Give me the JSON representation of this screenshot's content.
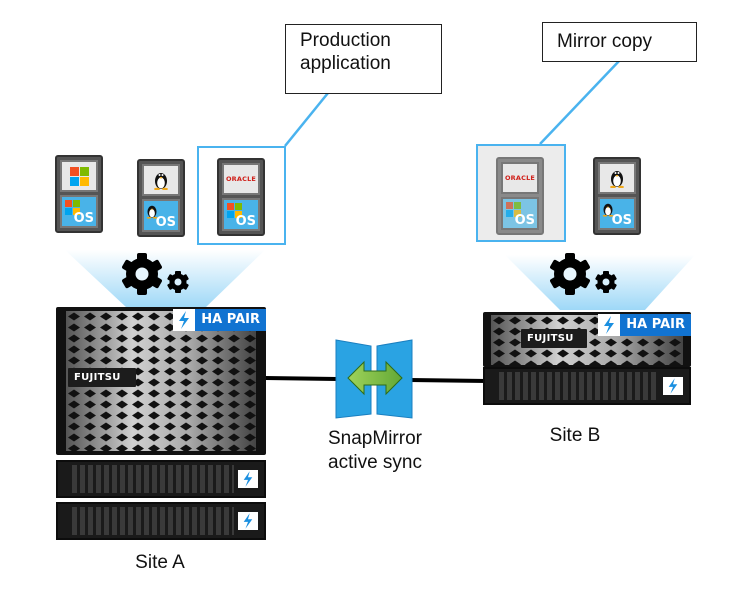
{
  "callouts": {
    "production": "Production application",
    "production_line1": "Production",
    "production_line2": "application",
    "mirror": "Mirror copy"
  },
  "site_a": {
    "label": "Site A",
    "vms": [
      {
        "app": "windows",
        "os": "windows-os"
      },
      {
        "app": "linux",
        "os": "linux-os"
      },
      {
        "app": "oracle",
        "os": "windows-os",
        "highlighted": true
      }
    ],
    "controller": {
      "badge": "HA PAIR",
      "brand": "FUJITSU"
    },
    "shelves": 2
  },
  "site_b": {
    "label": "Site B",
    "vms": [
      {
        "app": "oracle",
        "os": "windows-os",
        "highlighted": true
      },
      {
        "app": "linux",
        "os": "linux-os"
      }
    ],
    "controller": {
      "badge": "HA PAIR",
      "brand": "FUJITSU"
    },
    "shelves": 1
  },
  "link": {
    "line1": "SnapMirror",
    "line2": "active sync"
  },
  "os_label": "OS",
  "oracle_label": "ORACLE",
  "colors": {
    "highlight": "#4ab3ef",
    "ha_badge": "#1173d1",
    "os_tile": "#49b3e8",
    "arrow_green": "#7cc043",
    "snapmirror_blue": "#2aa3e3"
  }
}
